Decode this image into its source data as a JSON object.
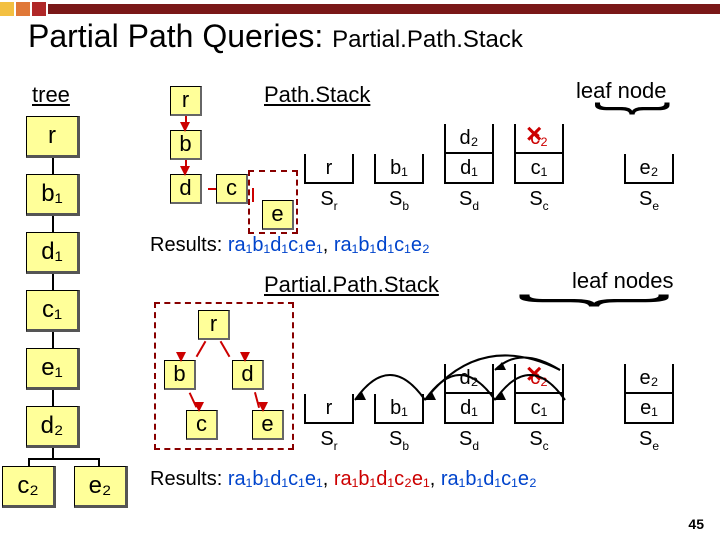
{
  "deco_colors": [
    "#f3c042",
    "#e07838",
    "#b02828",
    "#7a1818"
  ],
  "title_main": "Partial Path Queries: ",
  "title_sub": "Partial.Path.Stack",
  "tree_header": "tree",
  "tree_nodes": [
    "r",
    "b₁",
    "d₁",
    "c₁",
    "e₁",
    "d₂"
  ],
  "tree_children": [
    "c₂",
    "e₂"
  ],
  "section1": {
    "label": "Path.Stack",
    "leaf": "leaf node",
    "query": [
      "r",
      "b",
      "d",
      "c",
      "e"
    ],
    "stacks": [
      {
        "name": "Sᵣ",
        "cells": [
          "r"
        ]
      },
      {
        "name": "S_b",
        "cells": [
          "b₁"
        ]
      },
      {
        "name": "S_d",
        "cells": [
          "d₂",
          "d₁"
        ]
      },
      {
        "name": "S_c",
        "cells": [
          "c₂",
          "c₁"
        ]
      },
      {
        "name": "S_e",
        "cells": [
          "e₂"
        ]
      }
    ],
    "results_label": "Results: ",
    "r1": "ra₁b₁d₁c₁e₁",
    "r2": "ra₁b₁d₁c₁e₂"
  },
  "section2": {
    "label": "Partial.Path.Stack",
    "leaf": "leaf nodes",
    "query": [
      "r",
      "b",
      "d",
      "c",
      "e"
    ],
    "stacks": [
      {
        "name": "Sᵣ",
        "cells": [
          "r"
        ]
      },
      {
        "name": "S_b",
        "cells": [
          "b₁"
        ]
      },
      {
        "name": "S_d",
        "cells": [
          "d₂",
          "d₁"
        ]
      },
      {
        "name": "S_c",
        "cells": [
          "c₂",
          "c₁"
        ]
      },
      {
        "name": "S_e",
        "cells": [
          "e₂",
          "e₁"
        ]
      }
    ],
    "results_label": "Results: ",
    "r1": "ra₁b₁d₁c₁e₁",
    "r2": "ra₁b₁d₁c₂e₁",
    "r3": "ra₁b₁d₁c₁e₂"
  },
  "slide_num": "45"
}
